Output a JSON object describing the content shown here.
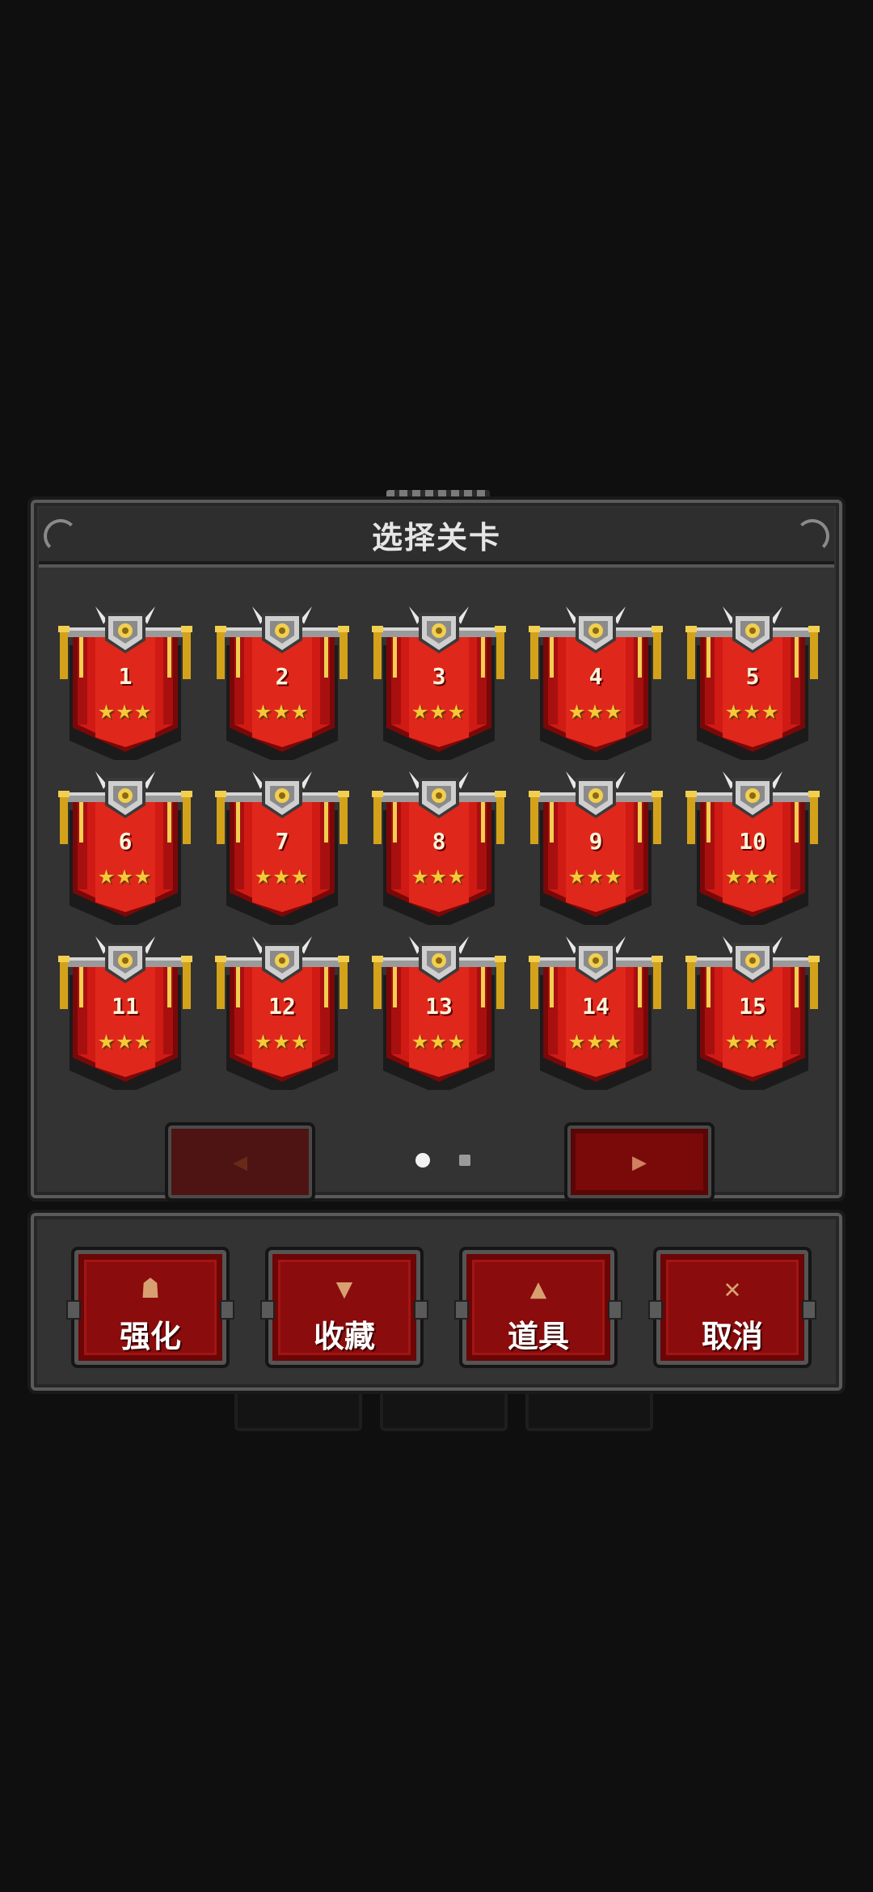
{
  "dialog": {
    "title": "选择关卡"
  },
  "levels": [
    {
      "num": "1",
      "stars": "★★★"
    },
    {
      "num": "2",
      "stars": "★★★"
    },
    {
      "num": "3",
      "stars": "★★★"
    },
    {
      "num": "4",
      "stars": "★★★"
    },
    {
      "num": "5",
      "stars": "★★★"
    },
    {
      "num": "6",
      "stars": "★★★"
    },
    {
      "num": "7",
      "stars": "★★★"
    },
    {
      "num": "8",
      "stars": "★★★"
    },
    {
      "num": "9",
      "stars": "★★★"
    },
    {
      "num": "10",
      "stars": "★★★"
    },
    {
      "num": "11",
      "stars": "★★★"
    },
    {
      "num": "12",
      "stars": "★★★"
    },
    {
      "num": "13",
      "stars": "★★★"
    },
    {
      "num": "14",
      "stars": "★★★"
    },
    {
      "num": "15",
      "stars": "★★★"
    }
  ],
  "pager": {
    "prev_icon": "◀",
    "next_icon": "▶",
    "current_page": 1,
    "total_pages": 2
  },
  "actions": [
    {
      "label": "强化",
      "icon": "☗",
      "icon_name": "upgrade-icon"
    },
    {
      "label": "收藏",
      "icon": "▼",
      "icon_name": "trophy-cup-icon"
    },
    {
      "label": "道具",
      "icon": "▲",
      "icon_name": "potion-flask-icon"
    },
    {
      "label": "取消",
      "icon": "✕",
      "icon_name": "crossed-swords-icon"
    }
  ],
  "colors": {
    "banner_red": "#d01a14",
    "banner_dark": "#8a0c0c",
    "star_gold": "#f6c83a",
    "panel_gray": "#333333",
    "background": "#0f0f0f"
  }
}
